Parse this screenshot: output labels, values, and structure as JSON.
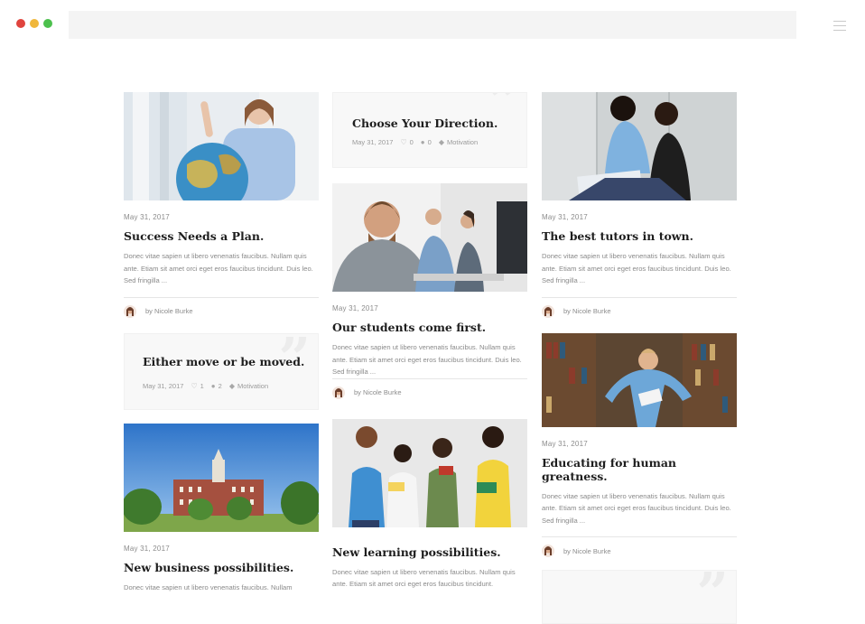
{
  "browser": {
    "dots": [
      {
        "name": "close-dot",
        "color": "#e0443e"
      },
      {
        "name": "minimize-dot",
        "color": "#f0b73c"
      },
      {
        "name": "maximize-dot",
        "color": "#4cc04d"
      }
    ]
  },
  "posts": {
    "p1": {
      "date": "May 31, 2017",
      "title": "Success Needs a Plan.",
      "excerpt": "Donec vitae sapien ut libero venenatis faucibus. Nullam quis ante. Etiam sit amet orci eget eros faucibus tincidunt. Duis leo. Sed fringilla ...",
      "author": "by Nicole Burke"
    },
    "q1": {
      "title": "Either move or be moved.",
      "date": "May 31, 2017",
      "likes": "1",
      "comments": "2",
      "category": "Motivation"
    },
    "p2": {
      "date": "May 31, 2017",
      "title": "New business possibilities.",
      "excerpt": "Donec vitae sapien ut libero venenatis faucibus. Nullam"
    },
    "q2": {
      "title": "Choose Your Direction.",
      "date": "May 31, 2017",
      "likes": "0",
      "comments": "0",
      "category": "Motivation"
    },
    "p3": {
      "date": "May 31, 2017",
      "title": "Our students come first.",
      "excerpt": "Donec vitae sapien ut libero venenatis faucibus. Nullam quis ante. Etiam sit amet orci eget eros faucibus tincidunt. Duis leo. Sed fringilla ...",
      "author": "by Nicole Burke"
    },
    "p4": {
      "title": "New learning possibilities.",
      "excerpt": "Donec vitae sapien ut libero venenatis faucibus. Nullam quis ante. Etiam sit amet orci eget eros faucibus tincidunt."
    },
    "p5": {
      "date": "May 31, 2017",
      "title": "The best tutors in town.",
      "excerpt": "Donec vitae sapien ut libero venenatis faucibus. Nullam quis ante. Etiam sit amet orci eget eros faucibus tincidunt. Duis leo. Sed fringilla ...",
      "author": "by Nicole Burke"
    },
    "p6": {
      "date": "May 31, 2017",
      "title": "Educating for human greatness.",
      "excerpt": "Donec vitae sapien ut libero venenatis faucibus. Nullam quis ante. Etiam sit amet orci eget eros faucibus tincidunt. Duis leo. Sed fringilla ...",
      "author": "by Nicole Burke"
    }
  },
  "icons": {
    "like": "heart-icon",
    "comment": "comment-icon",
    "category": "tag-icon",
    "quote": "quote-icon",
    "menu": "hamburger-menu-icon"
  }
}
